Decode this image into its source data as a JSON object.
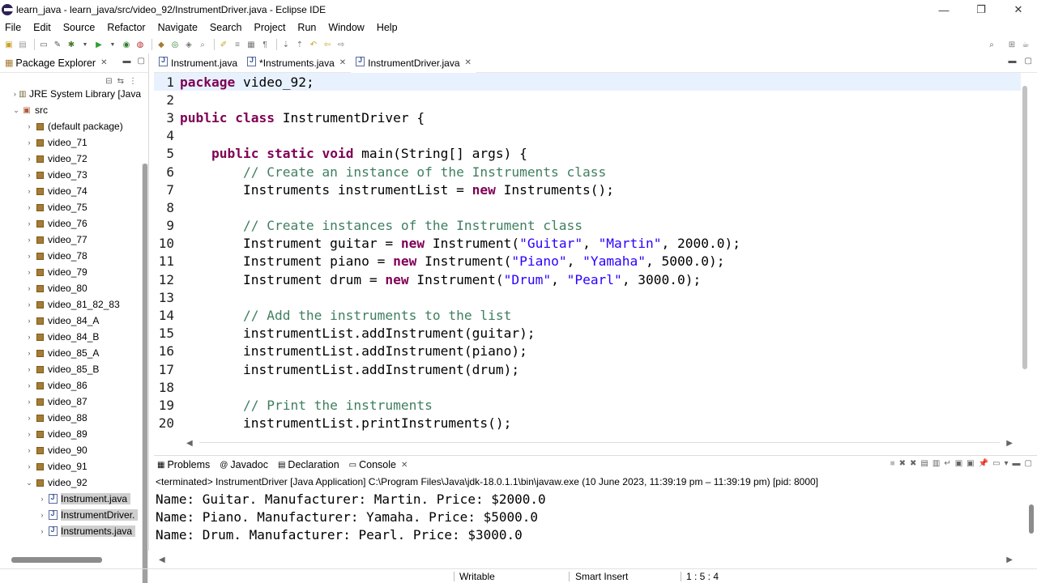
{
  "window": {
    "title": "learn_java - learn_java/src/video_92/InstrumentDriver.java - Eclipse IDE",
    "minimize": "—",
    "maximize": "❐",
    "close": "✕"
  },
  "menu": [
    "File",
    "Edit",
    "Source",
    "Refactor",
    "Navigate",
    "Search",
    "Project",
    "Run",
    "Window",
    "Help"
  ],
  "package_explorer": {
    "tab_label": "Package Explorer",
    "items": [
      {
        "label": "JRE System Library [Java",
        "indent": 1,
        "arrow": "›",
        "icon": "library-icon",
        "selected": false
      },
      {
        "label": "src",
        "indent": 1,
        "arrow": "⌄",
        "icon": "folder-icon",
        "selected": false
      },
      {
        "label": "(default package)",
        "indent": 2,
        "arrow": "›",
        "icon": "package-icon",
        "selected": false
      },
      {
        "label": "video_71",
        "indent": 2,
        "arrow": "›",
        "icon": "package-icon",
        "selected": false
      },
      {
        "label": "video_72",
        "indent": 2,
        "arrow": "›",
        "icon": "package-icon",
        "selected": false
      },
      {
        "label": "video_73",
        "indent": 2,
        "arrow": "›",
        "icon": "package-icon",
        "selected": false
      },
      {
        "label": "video_74",
        "indent": 2,
        "arrow": "›",
        "icon": "package-icon",
        "selected": false
      },
      {
        "label": "video_75",
        "indent": 2,
        "arrow": "›",
        "icon": "package-icon",
        "selected": false
      },
      {
        "label": "video_76",
        "indent": 2,
        "arrow": "›",
        "icon": "package-icon",
        "selected": false
      },
      {
        "label": "video_77",
        "indent": 2,
        "arrow": "›",
        "icon": "package-icon",
        "selected": false
      },
      {
        "label": "video_78",
        "indent": 2,
        "arrow": "›",
        "icon": "package-icon",
        "selected": false
      },
      {
        "label": "video_79",
        "indent": 2,
        "arrow": "›",
        "icon": "package-icon",
        "selected": false
      },
      {
        "label": "video_80",
        "indent": 2,
        "arrow": "›",
        "icon": "package-icon",
        "selected": false
      },
      {
        "label": "video_81_82_83",
        "indent": 2,
        "arrow": "›",
        "icon": "package-icon",
        "selected": false
      },
      {
        "label": "video_84_A",
        "indent": 2,
        "arrow": "›",
        "icon": "package-icon",
        "selected": false
      },
      {
        "label": "video_84_B",
        "indent": 2,
        "arrow": "›",
        "icon": "package-icon",
        "selected": false
      },
      {
        "label": "video_85_A",
        "indent": 2,
        "arrow": "›",
        "icon": "package-icon",
        "selected": false
      },
      {
        "label": "video_85_B",
        "indent": 2,
        "arrow": "›",
        "icon": "package-icon",
        "selected": false
      },
      {
        "label": "video_86",
        "indent": 2,
        "arrow": "›",
        "icon": "package-icon",
        "selected": false
      },
      {
        "label": "video_87",
        "indent": 2,
        "arrow": "›",
        "icon": "package-icon",
        "selected": false
      },
      {
        "label": "video_88",
        "indent": 2,
        "arrow": "›",
        "icon": "package-icon",
        "selected": false
      },
      {
        "label": "video_89",
        "indent": 2,
        "arrow": "›",
        "icon": "package-icon",
        "selected": false
      },
      {
        "label": "video_90",
        "indent": 2,
        "arrow": "›",
        "icon": "package-icon",
        "selected": false
      },
      {
        "label": "video_91",
        "indent": 2,
        "arrow": "›",
        "icon": "package-icon",
        "selected": false
      },
      {
        "label": "video_92",
        "indent": 2,
        "arrow": "⌄",
        "icon": "package-icon",
        "selected": false
      },
      {
        "label": "Instrument.java",
        "indent": 3,
        "arrow": "›",
        "icon": "java-file-icon",
        "selected": true
      },
      {
        "label": "InstrumentDriver.",
        "indent": 3,
        "arrow": "›",
        "icon": "java-file-icon",
        "selected": true
      },
      {
        "label": "Instruments.java",
        "indent": 3,
        "arrow": "›",
        "icon": "java-file-icon",
        "selected": true
      }
    ]
  },
  "editor": {
    "tabs": [
      {
        "label": "Instrument.java",
        "active": false,
        "closable": false
      },
      {
        "label": "*Instruments.java",
        "active": false,
        "closable": true
      },
      {
        "label": "InstrumentDriver.java",
        "active": true,
        "closable": true
      }
    ],
    "lines": [
      {
        "n": "1",
        "tokens": [
          [
            "kw",
            "package"
          ],
          [
            "src",
            " video_92;"
          ]
        ]
      },
      {
        "n": "2",
        "tokens": []
      },
      {
        "n": "3",
        "tokens": [
          [
            "kw",
            "public"
          ],
          [
            "src",
            " "
          ],
          [
            "kw",
            "class"
          ],
          [
            "src",
            " InstrumentDriver {"
          ]
        ]
      },
      {
        "n": "4",
        "tokens": []
      },
      {
        "n": "5",
        "tokens": [
          [
            "src",
            "    "
          ],
          [
            "kw",
            "public"
          ],
          [
            "src",
            " "
          ],
          [
            "kw",
            "static"
          ],
          [
            "src",
            " "
          ],
          [
            "kw",
            "void"
          ],
          [
            "src",
            " main(String[] args) {"
          ]
        ]
      },
      {
        "n": "6",
        "tokens": [
          [
            "src",
            "        "
          ],
          [
            "cm",
            "// Create an instance of the Instruments class"
          ]
        ]
      },
      {
        "n": "7",
        "tokens": [
          [
            "src",
            "        Instruments instrumentList = "
          ],
          [
            "kw",
            "new"
          ],
          [
            "src",
            " Instruments();"
          ]
        ]
      },
      {
        "n": "8",
        "tokens": []
      },
      {
        "n": "9",
        "tokens": [
          [
            "src",
            "        "
          ],
          [
            "cm",
            "// Create instances of the Instrument class"
          ]
        ]
      },
      {
        "n": "10",
        "tokens": [
          [
            "src",
            "        Instrument guitar = "
          ],
          [
            "kw",
            "new"
          ],
          [
            "src",
            " Instrument("
          ],
          [
            "st",
            "\"Guitar\""
          ],
          [
            "src",
            ", "
          ],
          [
            "st",
            "\"Martin\""
          ],
          [
            "src",
            ", 2000.0);"
          ]
        ]
      },
      {
        "n": "11",
        "tokens": [
          [
            "src",
            "        Instrument piano = "
          ],
          [
            "kw",
            "new"
          ],
          [
            "src",
            " Instrument("
          ],
          [
            "st",
            "\"Piano\""
          ],
          [
            "src",
            ", "
          ],
          [
            "st",
            "\"Yamaha\""
          ],
          [
            "src",
            ", 5000.0);"
          ]
        ]
      },
      {
        "n": "12",
        "tokens": [
          [
            "src",
            "        Instrument drum = "
          ],
          [
            "kw",
            "new"
          ],
          [
            "src",
            " Instrument("
          ],
          [
            "st",
            "\"Drum\""
          ],
          [
            "src",
            ", "
          ],
          [
            "st",
            "\"Pearl\""
          ],
          [
            "src",
            ", 3000.0);"
          ]
        ]
      },
      {
        "n": "13",
        "tokens": []
      },
      {
        "n": "14",
        "tokens": [
          [
            "src",
            "        "
          ],
          [
            "cm",
            "// Add the instruments to the list"
          ]
        ]
      },
      {
        "n": "15",
        "tokens": [
          [
            "src",
            "        instrumentList.addInstrument(guitar);"
          ]
        ]
      },
      {
        "n": "16",
        "tokens": [
          [
            "src",
            "        instrumentList.addInstrument(piano);"
          ]
        ]
      },
      {
        "n": "17",
        "tokens": [
          [
            "src",
            "        instrumentList.addInstrument(drum);"
          ]
        ]
      },
      {
        "n": "18",
        "tokens": []
      },
      {
        "n": "19",
        "tokens": [
          [
            "src",
            "        "
          ],
          [
            "cm",
            "// Print the instruments"
          ]
        ]
      },
      {
        "n": "20",
        "tokens": [
          [
            "src",
            "        instrumentList.printInstruments();"
          ]
        ]
      }
    ]
  },
  "bottom_panel": {
    "tabs": [
      {
        "label": "Problems",
        "active": false,
        "closable": false
      },
      {
        "label": "Javadoc",
        "active": false,
        "closable": false
      },
      {
        "label": "Declaration",
        "active": false,
        "closable": false
      },
      {
        "label": "Console",
        "active": true,
        "closable": true
      }
    ],
    "terminated": "<terminated> InstrumentDriver [Java Application] C:\\Program Files\\Java\\jdk-18.0.1.1\\bin\\javaw.exe  (10 June 2023, 11:39:19 pm – 11:39:19 pm) [pid: 8000]",
    "output": [
      "Name: Guitar. Manufacturer: Martin. Price: $2000.0",
      "Name: Piano. Manufacturer: Yamaha. Price: $5000.0",
      "Name: Drum. Manufacturer: Pearl. Price: $3000.0"
    ]
  },
  "status": {
    "writable": "Writable",
    "insert_mode": "Smart Insert",
    "position": "1 : 5 : 4"
  },
  "colors": {
    "keyword": "#7f0055",
    "comment": "#3f7f5f",
    "string": "#2a00ff",
    "current_line": "#e8f2fe"
  }
}
